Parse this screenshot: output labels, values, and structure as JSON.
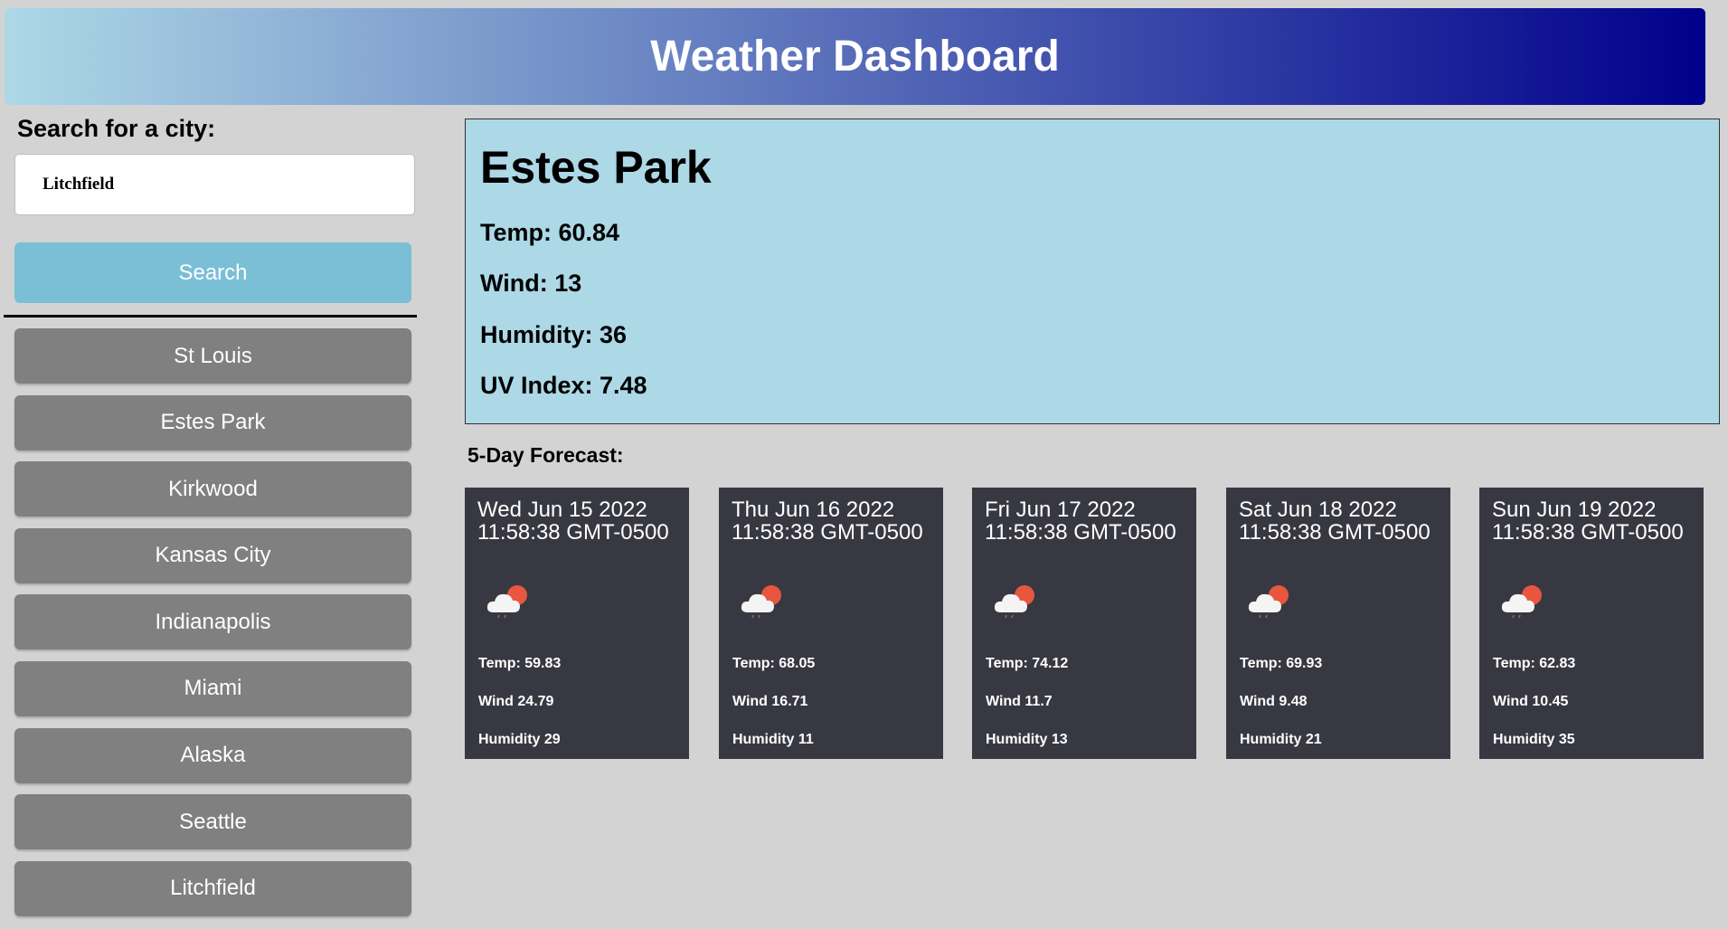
{
  "header": {
    "title": "Weather Dashboard"
  },
  "search": {
    "label": "Search for a city:",
    "value": "Litchfield",
    "button_label": "Search"
  },
  "history": [
    "St Louis",
    "Estes Park",
    "Kirkwood",
    "Kansas City",
    "Indianapolis",
    "Miami",
    "Alaska",
    "Seattle",
    "Litchfield"
  ],
  "current": {
    "city": "Estes Park",
    "temp": "Temp: 60.84",
    "wind": "Wind: 13",
    "humidity": "Humidity: 36",
    "uv": "UV Index: 7.48"
  },
  "forecast": {
    "label": "5-Day Forecast:",
    "days": [
      {
        "date": "Wed Jun 15 2022 11:58:38 GMT-0500",
        "icon": "partly-cloudy-rain-icon",
        "temp": "Temp: 59.83",
        "wind": "Wind 24.79",
        "humidity": "Humidity 29"
      },
      {
        "date": "Thu Jun 16 2022 11:58:38 GMT-0500",
        "icon": "partly-cloudy-rain-icon",
        "temp": "Temp: 68.05",
        "wind": "Wind 16.71",
        "humidity": "Humidity 11"
      },
      {
        "date": "Fri Jun 17 2022 11:58:38 GMT-0500",
        "icon": "partly-cloudy-rain-icon",
        "temp": "Temp: 74.12",
        "wind": "Wind 11.7",
        "humidity": "Humidity 13"
      },
      {
        "date": "Sat Jun 18 2022 11:58:38 GMT-0500",
        "icon": "partly-cloudy-rain-icon",
        "temp": "Temp: 69.93",
        "wind": "Wind 9.48",
        "humidity": "Humidity 21"
      },
      {
        "date": "Sun Jun 19 2022 11:58:38 GMT-0500",
        "icon": "partly-cloudy-rain-icon",
        "temp": "Temp: 62.83",
        "wind": "Wind 10.45",
        "humidity": "Humidity 35"
      }
    ]
  },
  "colors": {
    "header_gradient_start": "#add8e6",
    "header_gradient_end": "#00008b",
    "search_button": "#7bbfd7",
    "history_button": "#808080",
    "current_panel": "#add8e6",
    "forecast_card": "#383842",
    "sun": "#e8563f"
  }
}
